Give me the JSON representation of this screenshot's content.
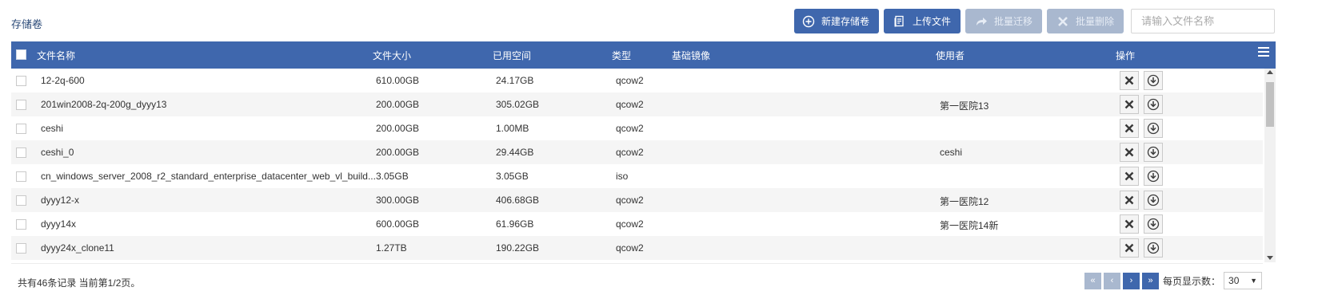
{
  "page": {
    "title": "存储卷"
  },
  "toolbar": {
    "new_volume": "新建存储卷",
    "upload_file": "上传文件",
    "batch_migrate": "批量迁移",
    "batch_delete": "批量删除",
    "search_placeholder": "请输入文件名称"
  },
  "table": {
    "columns": [
      "文件名称",
      "文件大小",
      "已用空间",
      "类型",
      "基础镜像",
      "使用者",
      "操作"
    ],
    "rows": [
      {
        "name": "12-2q-600",
        "size": "610.00GB",
        "used": "24.17GB",
        "type": "qcow2",
        "base_image": "",
        "user": ""
      },
      {
        "name": "201win2008-2q-200g_dyyy13",
        "size": "200.00GB",
        "used": "305.02GB",
        "type": "qcow2",
        "base_image": "",
        "user": "第一医院13"
      },
      {
        "name": "ceshi",
        "size": "200.00GB",
        "used": "1.00MB",
        "type": "qcow2",
        "base_image": "",
        "user": ""
      },
      {
        "name": "ceshi_0",
        "size": "200.00GB",
        "used": "29.44GB",
        "type": "qcow2",
        "base_image": "",
        "user": "ceshi"
      },
      {
        "name": "cn_windows_server_2008_r2_standard_enterprise_datacenter_web_vl_build...",
        "size": "3.05GB",
        "used": "3.05GB",
        "type": "iso",
        "base_image": "",
        "user": ""
      },
      {
        "name": "dyyy12-x",
        "size": "300.00GB",
        "used": "406.68GB",
        "type": "qcow2",
        "base_image": "",
        "user": "第一医院12"
      },
      {
        "name": "dyyy14x",
        "size": "600.00GB",
        "used": "61.96GB",
        "type": "qcow2",
        "base_image": "",
        "user": "第一医院14新"
      },
      {
        "name": "dyyy24x_clone11",
        "size": "1.27TB",
        "used": "190.22GB",
        "type": "qcow2",
        "base_image": "",
        "user": ""
      }
    ],
    "actions": [
      "close-icon",
      "download-icon"
    ]
  },
  "footer": {
    "summary": "共有46条记录 当前第1/2页。",
    "per_page_label": "每页显示数：",
    "per_page_value": "30"
  },
  "colors": {
    "primary": "#3f67ad",
    "disabled": "#a9b8cf",
    "title": "#2b4a78"
  }
}
